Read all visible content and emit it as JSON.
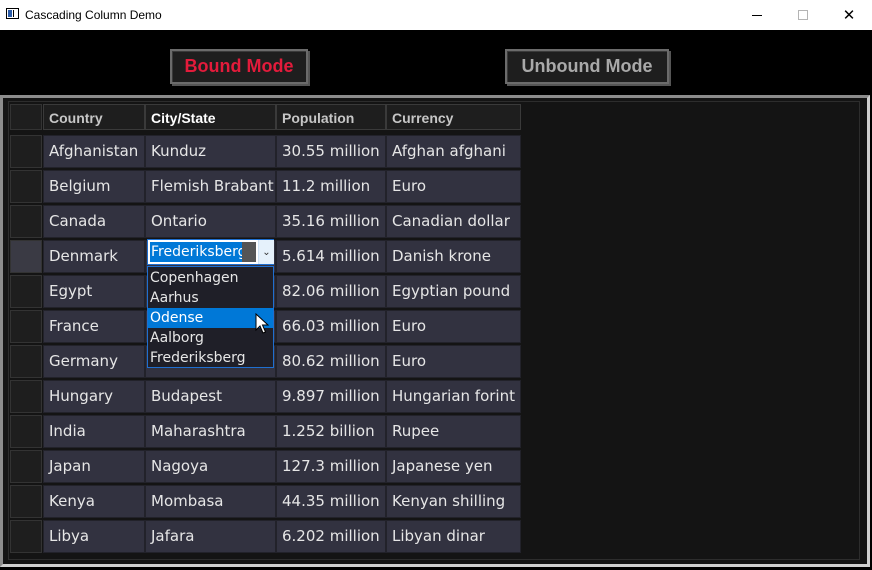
{
  "window": {
    "title": "Cascading Column Demo",
    "close_glyph": "✕"
  },
  "modes": {
    "bound_label": "Bound Mode",
    "unbound_label": "Unbound Mode"
  },
  "columns": [
    "Country",
    "City/State",
    "Population",
    "Currency"
  ],
  "rows": [
    {
      "country": "Afghanistan",
      "city": "Kunduz",
      "population": "30.55 million",
      "currency": "Afghan afghani"
    },
    {
      "country": "Belgium",
      "city": "Flemish Brabant",
      "population": "11.2 million",
      "currency": "Euro"
    },
    {
      "country": "Canada",
      "city": "Ontario",
      "population": "35.16 million",
      "currency": "Canadian dollar"
    },
    {
      "country": "Denmark",
      "city": "Frederiksberg",
      "population": "5.614 million",
      "currency": "Danish krone"
    },
    {
      "country": "Egypt",
      "city": "",
      "population": "82.06 million",
      "currency": "Egyptian pound"
    },
    {
      "country": "France",
      "city": "",
      "population": "66.03 million",
      "currency": "Euro"
    },
    {
      "country": "Germany",
      "city": "",
      "population": "80.62 million",
      "currency": "Euro"
    },
    {
      "country": "Hungary",
      "city": "Budapest",
      "population": "9.897 million",
      "currency": "Hungarian forint"
    },
    {
      "country": "India",
      "city": "Maharashtra",
      "population": "1.252 billion",
      "currency": "Rupee"
    },
    {
      "country": "Japan",
      "city": "Nagoya",
      "population": "127.3 million",
      "currency": "Japanese yen"
    },
    {
      "country": "Kenya",
      "city": "Mombasa",
      "population": "44.35 million",
      "currency": "Kenyan shilling"
    },
    {
      "country": "Libya",
      "city": "Jafara",
      "population": "6.202 million",
      "currency": "Libyan dinar"
    }
  ],
  "editor": {
    "value": "Frederiksberg",
    "options": [
      "Copenhagen",
      "Aarhus",
      "Odense",
      "Aalborg",
      "Frederiksberg"
    ],
    "highlighted_index": 2
  },
  "colors": {
    "bound_accent": "#e31b3b",
    "selection": "#0078d7"
  }
}
